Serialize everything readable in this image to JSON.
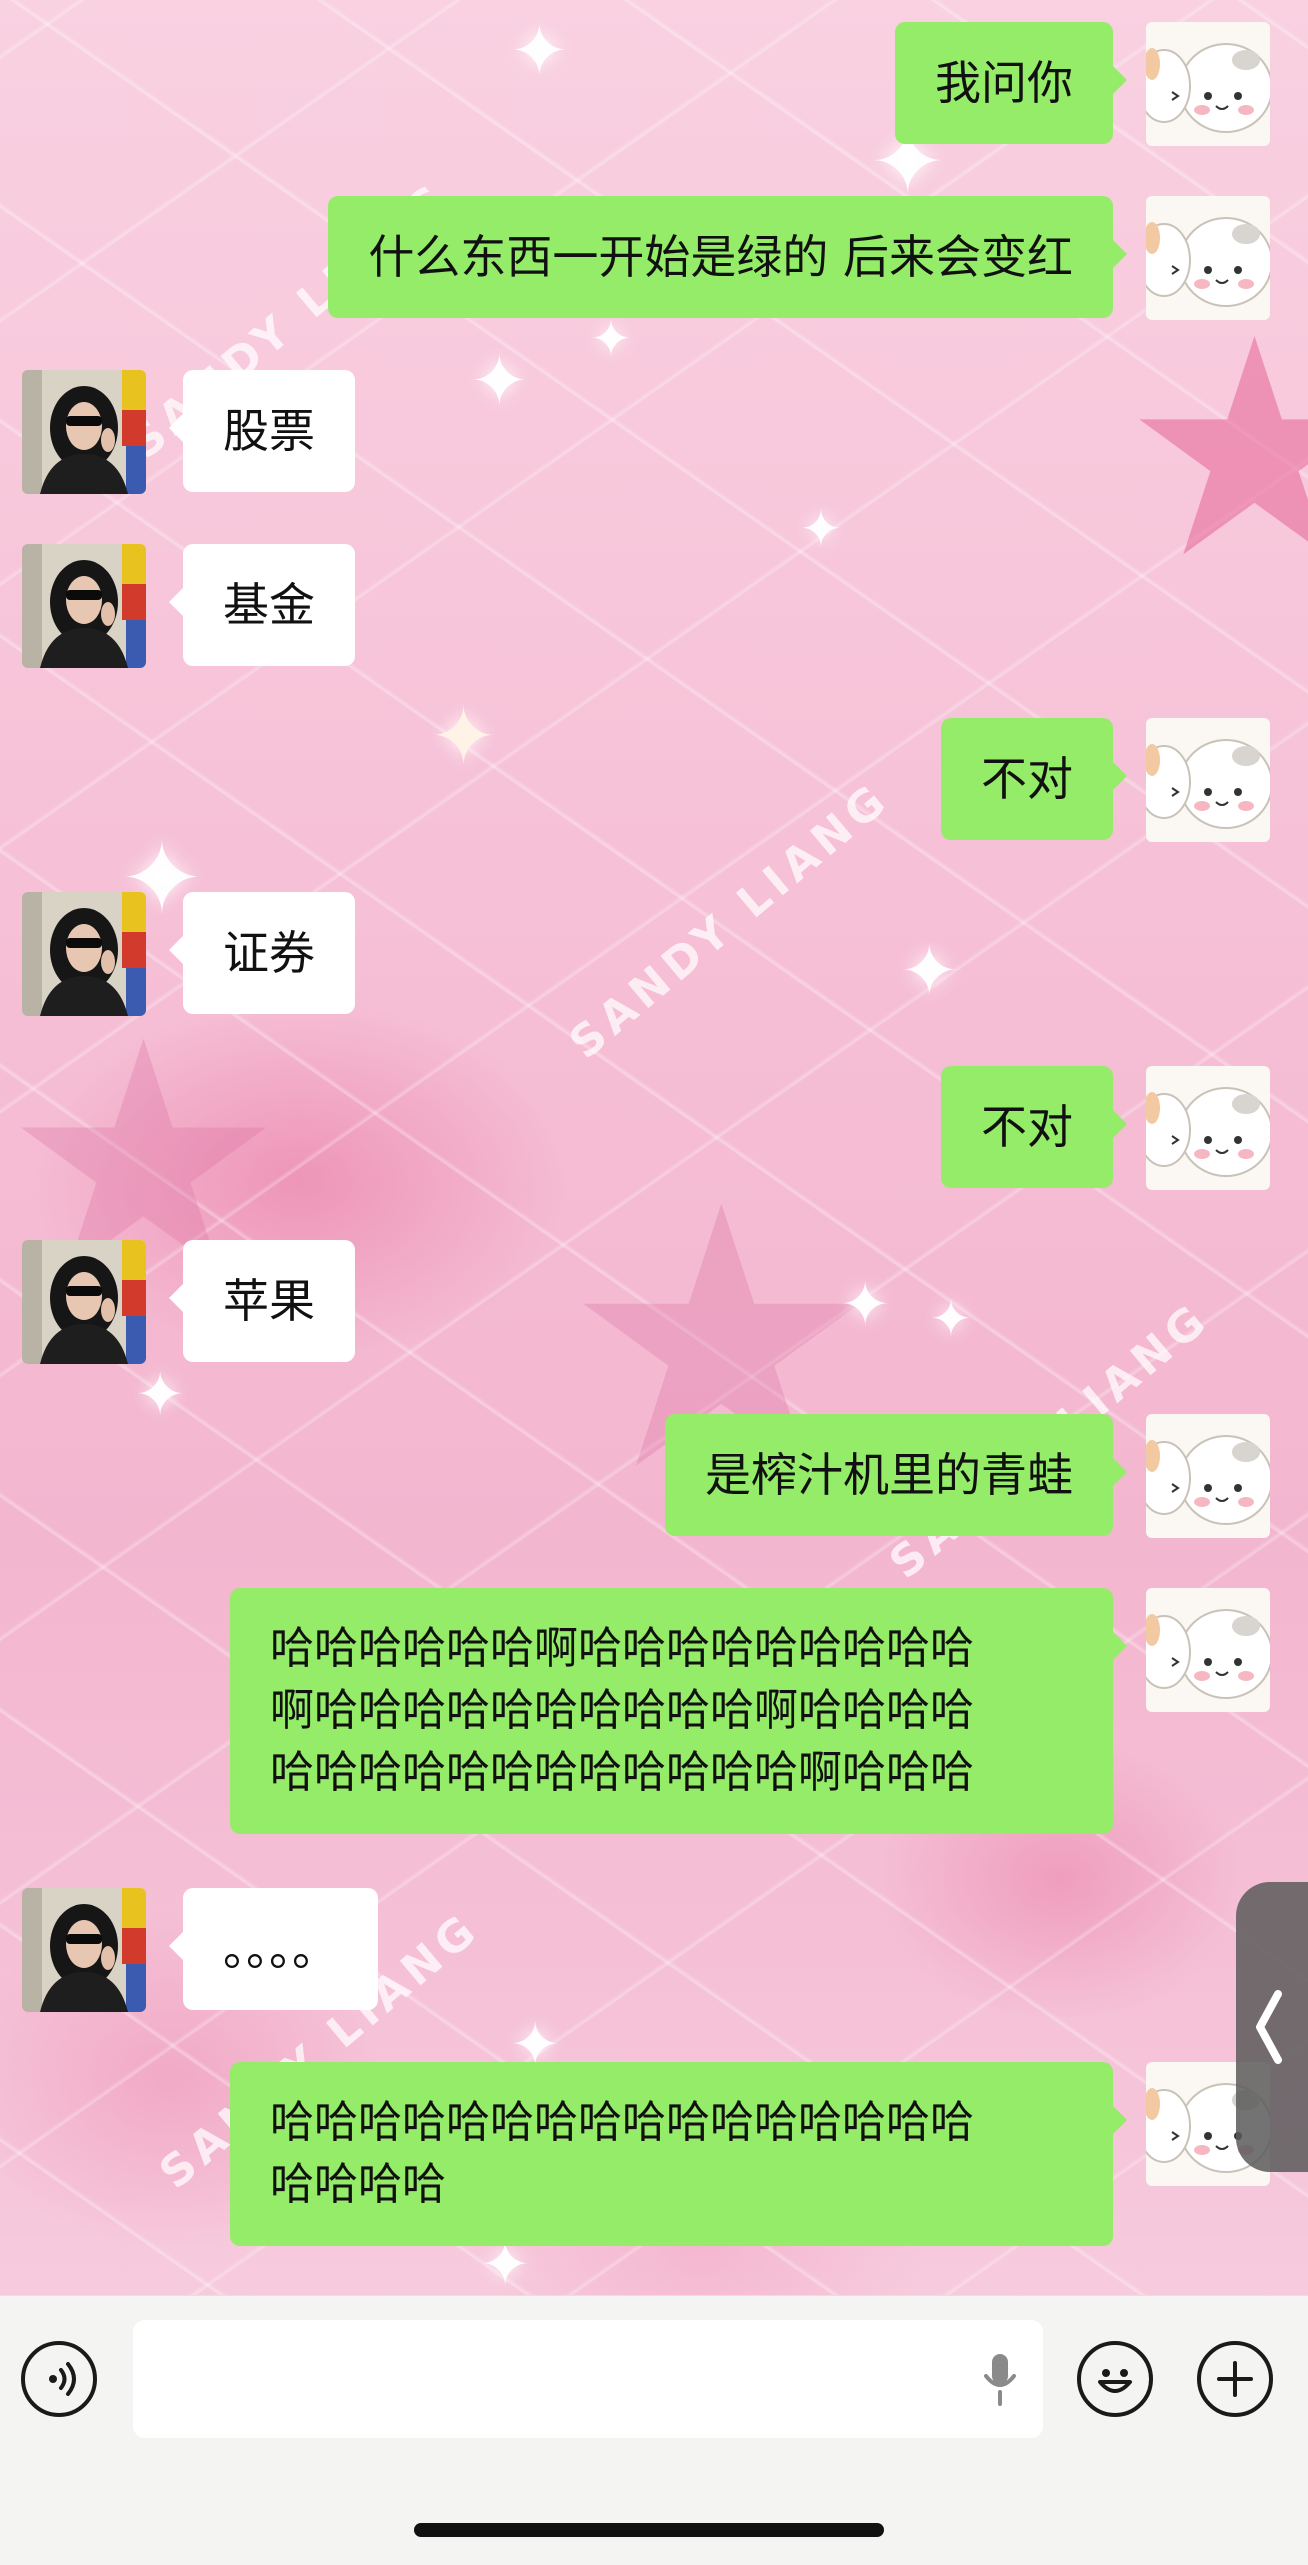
{
  "chat": {
    "messages": [
      {
        "sender": "me",
        "text": "我问你"
      },
      {
        "sender": "me",
        "text": "什么东西一开始是绿的 后来会变红"
      },
      {
        "sender": "them",
        "text": "股票"
      },
      {
        "sender": "them",
        "text": "基金"
      },
      {
        "sender": "me",
        "text": "不对"
      },
      {
        "sender": "them",
        "text": "证券"
      },
      {
        "sender": "me",
        "text": "不对"
      },
      {
        "sender": "them",
        "text": "苹果"
      },
      {
        "sender": "me",
        "text": "是榨汁机里的青蛙"
      },
      {
        "sender": "me",
        "lines": [
          "哈哈哈哈哈哈啊哈哈哈哈哈哈哈哈哈",
          "啊哈哈哈哈哈哈哈哈哈哈啊哈哈哈哈",
          "哈哈哈哈哈哈哈哈哈哈哈哈啊哈哈哈"
        ]
      },
      {
        "sender": "them",
        "text": "。。。。"
      },
      {
        "sender": "me",
        "lines": [
          "哈哈哈哈哈哈哈哈哈哈哈哈哈哈哈哈",
          "哈哈哈哈"
        ]
      }
    ]
  },
  "background": {
    "watermark": "SANDY LIANG"
  },
  "input_bar": {
    "voice_icon": "voice-mode-icon",
    "mic_icon": "microphone-icon",
    "emoji_icon": "emoji-icon",
    "plus_icon": "plus-icon"
  },
  "side_tab": {
    "icon": "chevron-left-icon"
  },
  "colors": {
    "my_bubble": "#95ec69",
    "their_bubble": "#ffffff",
    "background_pink": "#f6c0d6"
  }
}
